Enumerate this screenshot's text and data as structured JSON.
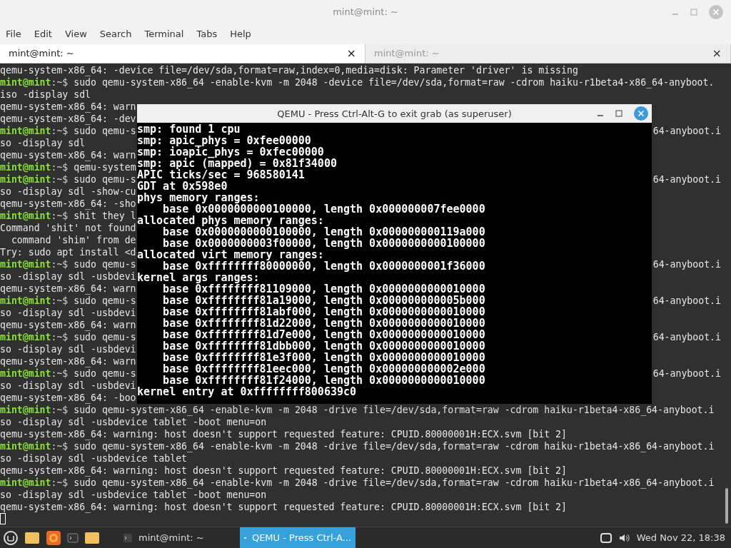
{
  "window": {
    "title": "mint@mint: ~"
  },
  "menu": [
    "File",
    "Edit",
    "View",
    "Search",
    "Terminal",
    "Tabs",
    "Help"
  ],
  "tabs": [
    {
      "label": "mint@mint: ~",
      "close": "×",
      "selected": true
    },
    {
      "label": "mint@mint: ~",
      "close": "×",
      "selected": false
    }
  ],
  "terminal": {
    "lines": [
      {
        "kind": "output",
        "text": "qemu-system-x86_64: -device file=/dev/sda,format=raw,index=0,media=disk: Parameter 'driver' is missing"
      },
      {
        "kind": "command",
        "user": "mint@mint",
        "path": ":~$",
        "text": " sudo qemu-system-x86_64 -enable-kvm -m 2048 -device file=/dev/sda,format=raw -cdrom haiku-r1beta4-x86_64-anyboot."
      },
      {
        "kind": "output",
        "text": "iso -display sdl"
      },
      {
        "kind": "output",
        "text": "qemu-system-x86_64: warn"
      },
      {
        "kind": "output",
        "text": "qemu-system-x86_64: -dev"
      },
      {
        "kind": "command",
        "user": "mint@mint",
        "path": ":~$",
        "text": " sudo qemu-s",
        "right": "64-anyboot.i"
      },
      {
        "kind": "output",
        "text": "so -display sdl"
      },
      {
        "kind": "output",
        "text": "qemu-system-x86_64: warn"
      },
      {
        "kind": "command",
        "user": "mint@mint",
        "path": ":~$",
        "text": " qemu-system"
      },
      {
        "kind": "command",
        "user": "mint@mint",
        "path": ":~$",
        "text": " sudo qemu-s",
        "right": "64-anyboot.i"
      },
      {
        "kind": "output",
        "text": "so -display sdl -show-cu"
      },
      {
        "kind": "output",
        "text": "qemu-system-x86_64: -sho"
      },
      {
        "kind": "command",
        "user": "mint@mint",
        "path": ":~$",
        "text": " shit they l"
      },
      {
        "kind": "output",
        "text": "Command 'shit' not found"
      },
      {
        "kind": "output",
        "text": "  command 'shim' from de"
      },
      {
        "kind": "output",
        "text": "Try: sudo apt install <d"
      },
      {
        "kind": "command",
        "user": "mint@mint",
        "path": ":~$",
        "text": " sudo qemu-s",
        "right": "64-anyboot.i"
      },
      {
        "kind": "output",
        "text": "so -display sdl -usbdevi"
      },
      {
        "kind": "output",
        "text": "qemu-system-x86_64: warn"
      },
      {
        "kind": "command",
        "user": "mint@mint",
        "path": ":~$",
        "text": " sudo qemu-s",
        "right": "64-anyboot.i"
      },
      {
        "kind": "output",
        "text": "so -display sdl -usbdevi"
      },
      {
        "kind": "output",
        "text": "qemu-system-x86_64: warn"
      },
      {
        "kind": "command",
        "user": "mint@mint",
        "path": ":~$",
        "text": " sudo qemu-s",
        "right": "64-anyboot.i"
      },
      {
        "kind": "output",
        "text": "so -display sdl -usbdevi"
      },
      {
        "kind": "output",
        "text": "qemu-system-x86_64: warn"
      },
      {
        "kind": "command",
        "user": "mint@mint",
        "path": ":~$",
        "text": " sudo qemu-s",
        "right": "64-anyboot.i"
      },
      {
        "kind": "output",
        "text": "so -display sdl -usbdevi"
      },
      {
        "kind": "output",
        "text": "qemu-system-x86_64: -boo"
      },
      {
        "kind": "command",
        "user": "mint@mint",
        "path": ":~$",
        "text": " sudo qemu-system-x86_64 -enable-kvm -m 2048 -drive file=/dev/sda,format=raw -cdrom haiku-r1beta4-x86_64-anyboot.i"
      },
      {
        "kind": "output",
        "text": "so -display sdl -usbdevice tablet -boot menu=on"
      },
      {
        "kind": "output",
        "text": "qemu-system-x86_64: warning: host doesn't support requested feature: CPUID.80000001H:ECX.svm [bit 2]"
      },
      {
        "kind": "command",
        "user": "mint@mint",
        "path": ":~$",
        "text": " sudo qemu-system-x86_64 -enable-kvm -m 2048 -drive file=/dev/sda,format=raw -cdrom haiku-r1beta4-x86_64-anyboot.i"
      },
      {
        "kind": "output",
        "text": "so -display sdl -usbdevice tablet"
      },
      {
        "kind": "output",
        "text": "qemu-system-x86_64: warning: host doesn't support requested feature: CPUID.80000001H:ECX.svm [bit 2]"
      },
      {
        "kind": "command",
        "user": "mint@mint",
        "path": ":~$",
        "text": " sudo qemu-system-x86_64 -enable-kvm -m 2048 -drive file=/dev/sda,format=raw -cdrom haiku-r1beta4-x86_64-anyboot.i"
      },
      {
        "kind": "output",
        "text": "so -display sdl -usbdevice tablet -boot menu=on"
      },
      {
        "kind": "output",
        "text": "qemu-system-x86_64: warning: host doesn't support requested feature: CPUID.80000001H:ECX.svm [bit 2]"
      }
    ]
  },
  "qemu": {
    "title": "QEMU - Press Ctrl-Alt-G to exit grab (as superuser)",
    "lines": [
      "smp: found 1 cpu",
      "smp: apic_phys = 0xfee00000",
      "smp: ioapic_phys = 0xfec00000",
      "smp: apic (mapped) = 0x81f34000",
      "APIC ticks/sec = 968580141",
      "GDT at 0x598e0",
      "phys memory ranges:",
      "    base 0x0000000000100000, length 0x000000007fee0000",
      "allocated phys memory ranges:",
      "    base 0x0000000000100000, length 0x000000000119a000",
      "    base 0x0000000003f00000, length 0x0000000000100000",
      "allocated virt memory ranges:",
      "    base 0xffffffff80000000, length 0x0000000001f36000",
      "kernel args ranges:",
      "    base 0xffffffff81109000, length 0x0000000000010000",
      "    base 0xffffffff81a19000, length 0x000000000005b000",
      "    base 0xffffffff81abf000, length 0x0000000000010000",
      "    base 0xffffffff81d22000, length 0x0000000000010000",
      "    base 0xffffffff81d7e000, length 0x0000000000010000",
      "    base 0xffffffff81dbb000, length 0x0000000000010000",
      "    base 0xffffffff81e3f000, length 0x0000000000010000",
      "    base 0xffffffff81eec000, length 0x000000000002e000",
      "    base 0xffffffff81f24000, length 0x0000000000010000",
      "kernel entry at 0xffffffff800639c0"
    ]
  },
  "taskbar": {
    "windows": [
      {
        "label": "mint@mint: ~",
        "kind": "terminal",
        "selected": false
      },
      {
        "label": "QEMU - Press Ctrl-A...",
        "kind": "qemu",
        "selected": true
      }
    ],
    "clock": "Wed Nov 22, 18:38"
  }
}
